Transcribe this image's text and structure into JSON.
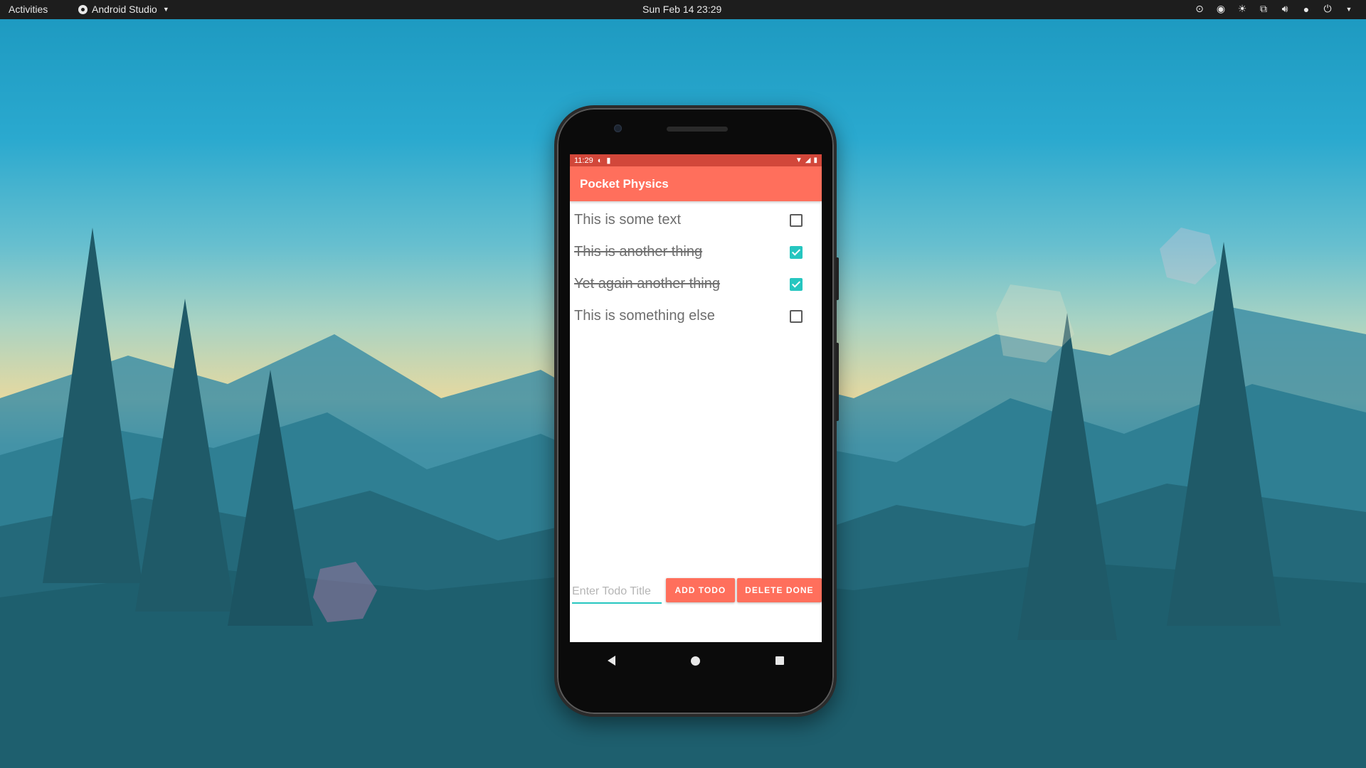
{
  "topbar": {
    "activities": "Activities",
    "app_menu": "Android Studio",
    "clock": "Sun Feb 14  23:29",
    "tray_icons": [
      "discord-icon",
      "steam-icon",
      "brightness-icon",
      "network-icon",
      "volume-icon",
      "microphone-icon",
      "power-icon",
      "menu-caret-icon"
    ]
  },
  "phone": {
    "status_time": "11:29",
    "app_title": "Pocket Physics",
    "todos": [
      {
        "text": "This is some text",
        "done": false
      },
      {
        "text": "This is another thing",
        "done": true
      },
      {
        "text": "Yet again another thing",
        "done": true
      },
      {
        "text": "This is something else",
        "done": false
      }
    ],
    "input_placeholder": "Enter Todo Title",
    "add_button": "ADD TODO",
    "delete_button": "DELETE DONE"
  },
  "colors": {
    "app_bar": "#ff6f5c",
    "status_bar": "#d2473a",
    "accent": "#26c6c0",
    "topbar": "#1d1d1d"
  }
}
